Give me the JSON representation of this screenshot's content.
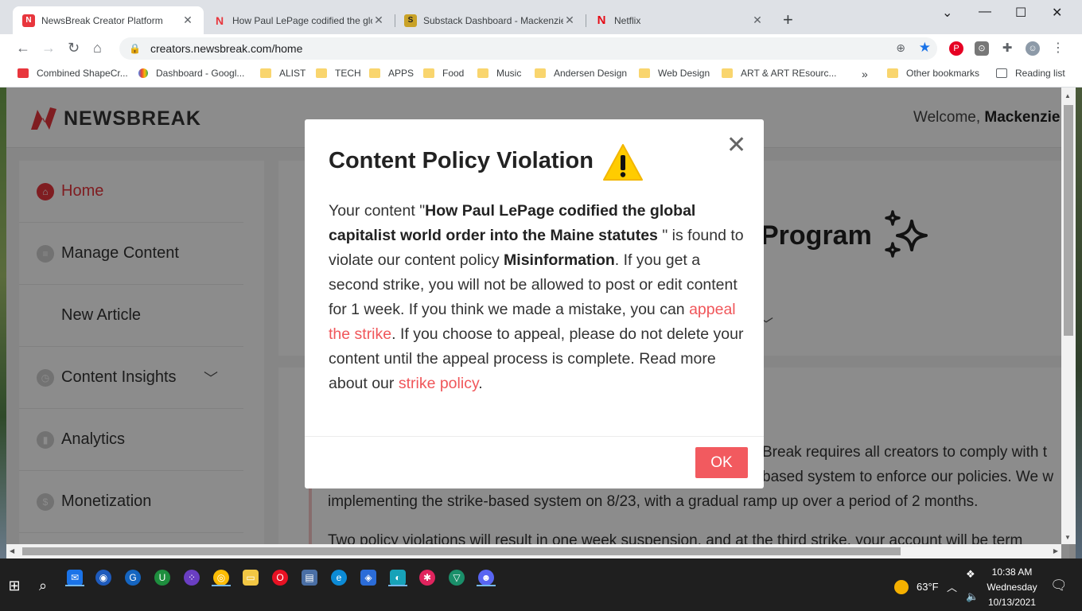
{
  "browser": {
    "tabs": [
      {
        "title": "NewsBreak Creator Platform",
        "favicon": "N",
        "color": "#e8363d",
        "active": true
      },
      {
        "title": "How Paul LePage codified the glo",
        "favicon": "N",
        "color": "#e8363d",
        "active": false
      },
      {
        "title": "Substack Dashboard - Mackenzie",
        "favicon": "S",
        "color": "#c9a227",
        "active": false
      },
      {
        "title": "Netflix",
        "favicon": "N",
        "color": "#e50914",
        "active": false
      }
    ],
    "url": "creators.newsbreak.com/home",
    "bookmarks": [
      "Combined ShapeCr...",
      "Dashboard - Googl...",
      "ALIST",
      "TECH",
      "APPS",
      "Food",
      "Music",
      "Andersen Design",
      "Web Design",
      "ART & ART REsourc...",
      "Other bookmarks",
      "Reading list"
    ]
  },
  "site": {
    "logo": "NEWSBREAK",
    "welcome_prefix": "Welcome, ",
    "welcome_name": "Mackenzie",
    "sidebar": [
      {
        "label": "Home",
        "active": true
      },
      {
        "label": "Manage Content"
      },
      {
        "label": "New Article"
      },
      {
        "label": "Content Insights"
      },
      {
        "label": "Analytics"
      },
      {
        "label": "Monetization"
      }
    ],
    "program_title": "Program",
    "body_lines": [
      "Break requires all creators to comply with t",
      "based system to enforce our policies. We w",
      "implementing the strike-based system on 8/23, with a gradual ramp up over a period of 2 months.",
      "Two policy violations will result in one week suspension, and at the third strike, your account will be term"
    ]
  },
  "modal": {
    "title": "Content Policy Violation",
    "text_1": "Your content \"",
    "article": "How Paul LePage codified the global capitalist world order into the Maine statutes ",
    "text_2": "\" is found to violate our content policy ",
    "policy": "Misinformation",
    "text_3": ". If you get a second strike, you will not be allowed to post or edit content for 1 week. If you think we made a mistake, you can ",
    "appeal_link": "appeal the strike",
    "text_4": ". If you choose to appeal, please do not delete your content until the appeal process is complete. Read more about our ",
    "policy_link": "strike policy",
    "text_5": ".",
    "ok_label": "OK",
    "accent": "#f25a5f"
  },
  "taskbar": {
    "weather": "63°F",
    "time": "10:38 AM",
    "day": "Wednesday",
    "date": "10/13/2021"
  }
}
